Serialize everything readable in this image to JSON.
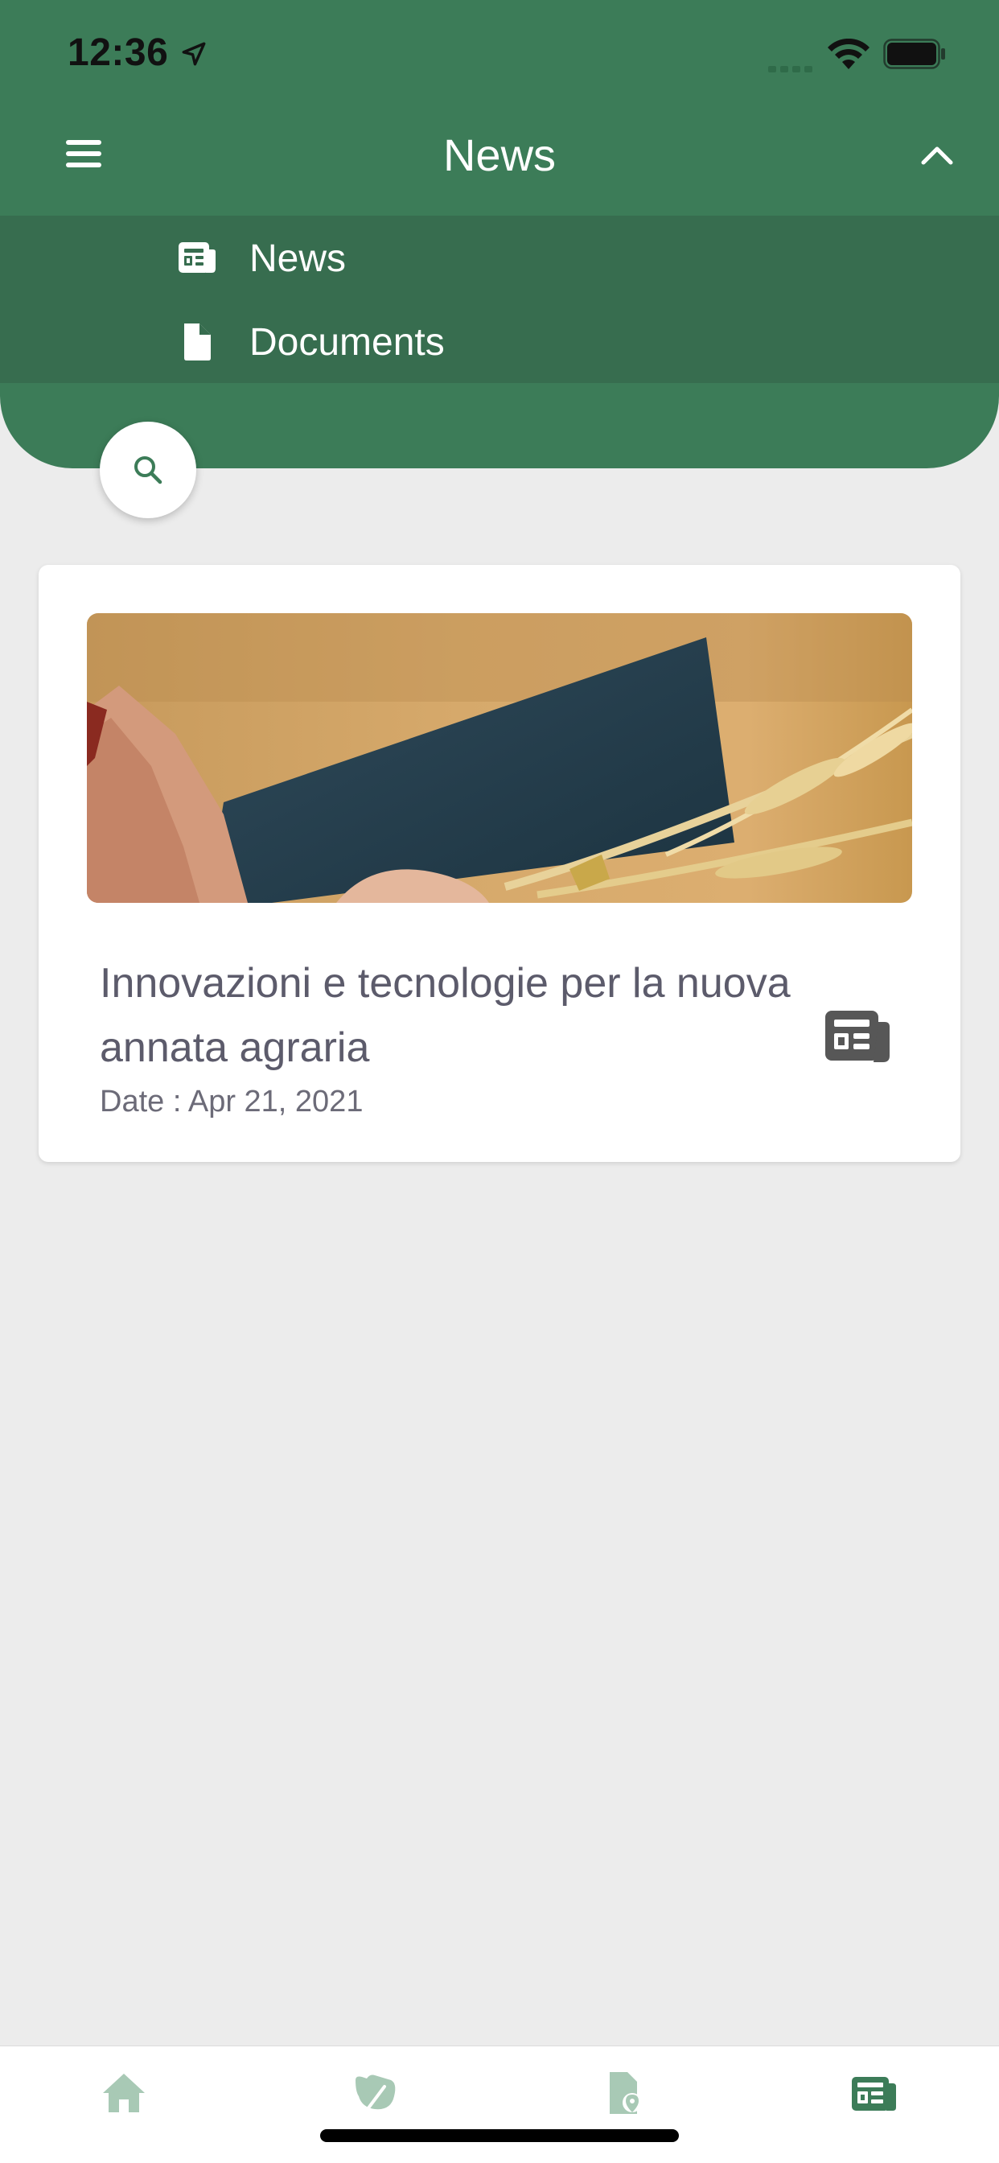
{
  "status_bar": {
    "time": "12:36"
  },
  "header": {
    "title": "News",
    "menu_icon": "hamburger-icon",
    "collapse_icon": "chevron-up-icon"
  },
  "dropdown": {
    "items": [
      {
        "label": "News",
        "icon": "newspaper-icon"
      },
      {
        "label": "Documents",
        "icon": "document-icon"
      }
    ]
  },
  "search": {
    "icon": "search-icon"
  },
  "news": {
    "items": [
      {
        "title": "Innovazioni e tecnologie per la nuova annata agraria",
        "date_label": "Date : ",
        "date": "Apr 21, 2021",
        "type_icon": "newspaper-icon"
      }
    ]
  },
  "tab_bar": {
    "tabs": [
      {
        "icon": "home-icon",
        "active": false
      },
      {
        "icon": "leaf-icon",
        "active": false
      },
      {
        "icon": "document-location-icon",
        "active": false
      },
      {
        "icon": "newspaper-icon",
        "active": true
      }
    ]
  },
  "colors": {
    "primary_green": "#3c7c58",
    "dropdown_green": "#376d4f",
    "background": "#ececec",
    "inactive_tab": "#a8c9b5",
    "text_gray": "#5c5b6b"
  }
}
